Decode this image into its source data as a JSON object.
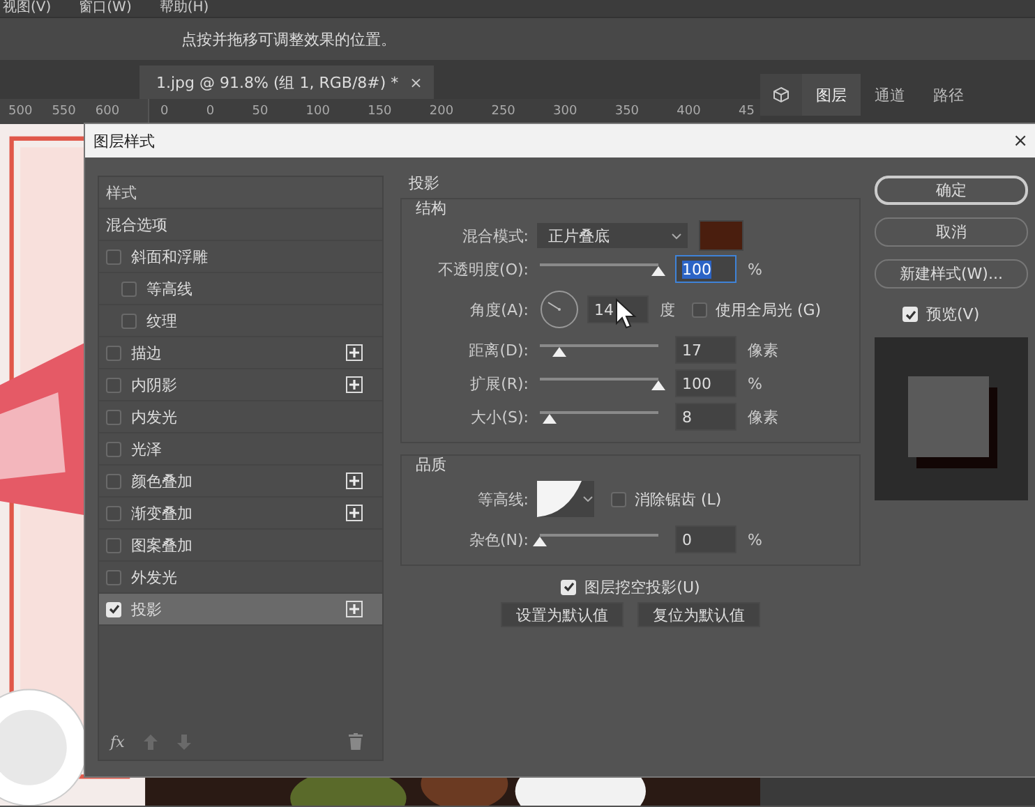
{
  "menu": [
    "视图(V)",
    "窗口(W)",
    "帮助(H)"
  ],
  "options_hint": "点按并拖移可调整效果的位置。",
  "document_tab": {
    "title": "1.jpg @ 91.8% (组 1, RGB/8#) *",
    "close": "×"
  },
  "side_ruler": [
    "500",
    "550",
    "600"
  ],
  "ruler": [
    "0",
    "0",
    "50",
    "100",
    "150",
    "200",
    "250",
    "300",
    "350",
    "400",
    "45"
  ],
  "panel_tabs": [
    {
      "label": "图层",
      "selected": true
    },
    {
      "label": "通道",
      "selected": false
    },
    {
      "label": "路径",
      "selected": false
    }
  ],
  "dialog": {
    "title": "图层样式",
    "close": "×",
    "styles": [
      {
        "label": "样式",
        "kind": "header",
        "selected": false
      },
      {
        "label": "混合选项",
        "kind": "plain",
        "selected": false
      },
      {
        "label": "斜面和浮雕",
        "kind": "check",
        "checked": false,
        "has_add": false,
        "selected": false,
        "children": [
          {
            "label": "等高线",
            "kind": "check",
            "checked": false,
            "has_add": false,
            "selected": false
          },
          {
            "label": "纹理",
            "kind": "check",
            "checked": false,
            "has_add": false,
            "selected": false
          }
        ]
      },
      {
        "label": "描边",
        "kind": "check",
        "checked": false,
        "has_add": true,
        "selected": false
      },
      {
        "label": "内阴影",
        "kind": "check",
        "checked": false,
        "has_add": true,
        "selected": false
      },
      {
        "label": "内发光",
        "kind": "check",
        "checked": false,
        "has_add": false,
        "selected": false
      },
      {
        "label": "光泽",
        "kind": "check",
        "checked": false,
        "has_add": false,
        "selected": false
      },
      {
        "label": "颜色叠加",
        "kind": "check",
        "checked": false,
        "has_add": true,
        "selected": false
      },
      {
        "label": "渐变叠加",
        "kind": "check",
        "checked": false,
        "has_add": true,
        "selected": false
      },
      {
        "label": "图案叠加",
        "kind": "check",
        "checked": false,
        "has_add": false,
        "selected": false
      },
      {
        "label": "外发光",
        "kind": "check",
        "checked": false,
        "has_add": false,
        "selected": false
      },
      {
        "label": "投影",
        "kind": "check",
        "checked": true,
        "has_add": true,
        "selected": true
      }
    ],
    "list_footer": {
      "fx": "fx"
    },
    "section_title": "投影",
    "structure": {
      "title": "结构",
      "blend_mode": {
        "label": "混合模式:",
        "value": "正片叠底",
        "color": "#4a1e0e"
      },
      "opacity": {
        "label": "不透明度(O):",
        "level": 1,
        "value": "100",
        "unit": "%",
        "focused": true
      },
      "angle": {
        "label": "角度(A):",
        "value": "14",
        "unit": "度",
        "global_light": {
          "label": "使用全局光 (G)",
          "checked": false
        }
      },
      "distance": {
        "label": "距离(D):",
        "level": 0.17,
        "value": "17",
        "unit": "像素"
      },
      "spread": {
        "label": "扩展(R):",
        "level": 1,
        "value": "100",
        "unit": "%"
      },
      "size": {
        "label": "大小(S):",
        "level": 0.08,
        "value": "8",
        "unit": "像素"
      }
    },
    "quality": {
      "title": "品质",
      "contour": {
        "label": "等高线:"
      },
      "anti_alias": {
        "label": "消除锯齿 (L)",
        "checked": false
      },
      "noise": {
        "label": "杂色(N):",
        "level": 0,
        "value": "0",
        "unit": "%"
      }
    },
    "knockout": {
      "label": "图层挖空投影(U)",
      "checked": true
    },
    "default_buttons": [
      "设置为默认值",
      "复位为默认值"
    ],
    "buttons": [
      {
        "label": "确定",
        "selected": true
      },
      {
        "label": "取消",
        "selected": false
      },
      {
        "label": "新建样式(W)...",
        "selected": false
      }
    ],
    "preview": {
      "label": "预览(V)",
      "checked": true
    }
  }
}
